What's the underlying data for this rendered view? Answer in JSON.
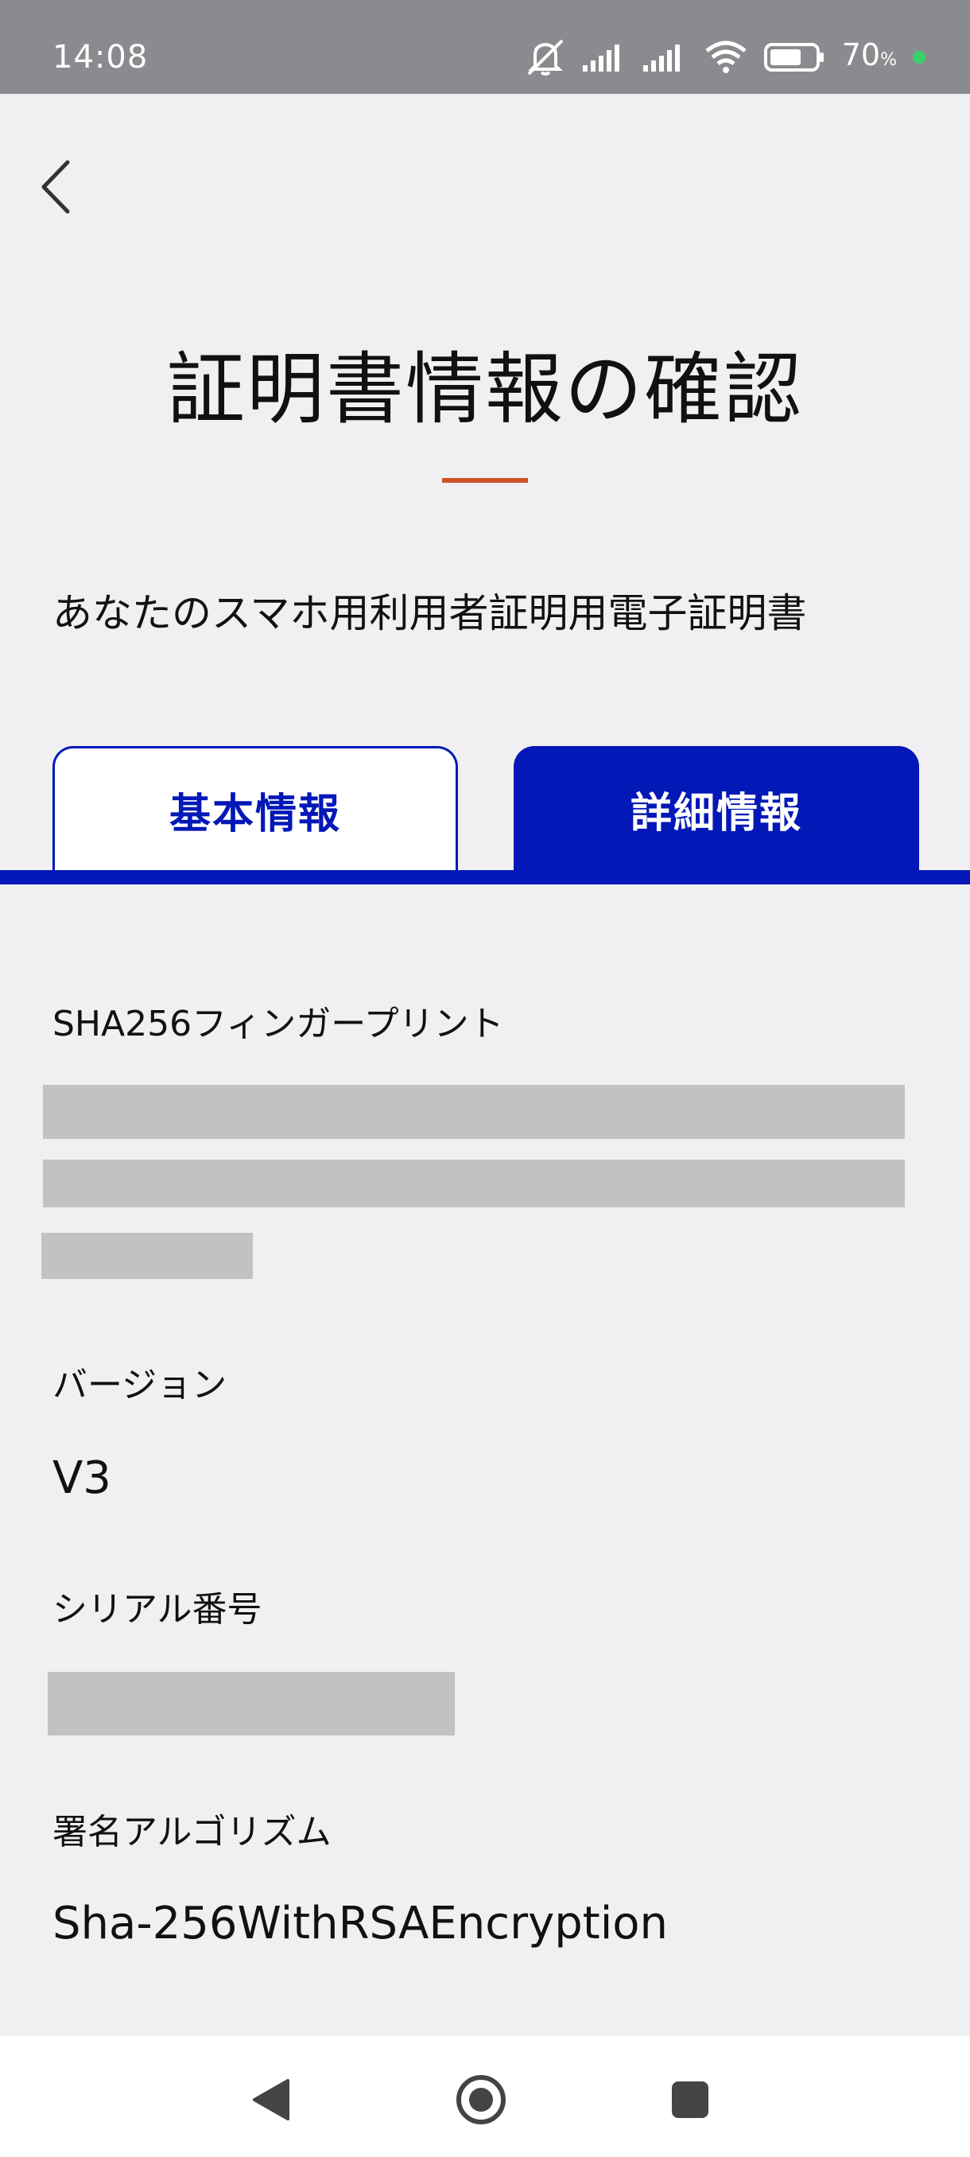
{
  "status_bar": {
    "time": "14:08",
    "battery_percent": "70",
    "battery_unit": "%",
    "battery_level": 0.7,
    "icons": [
      "mute-icon",
      "signal-icon",
      "signal-icon",
      "wifi-icon",
      "battery-icon",
      "charging-dot"
    ]
  },
  "header": {
    "back_icon": "chevron-left-icon",
    "title": "証明書情報の確認",
    "accent_color": "#d0522a"
  },
  "subtitle": "あなたのスマホ用利用者証明用電子証明書",
  "tabs": [
    {
      "label": "基本情報",
      "selected": false
    },
    {
      "label": "詳細情報",
      "selected": true
    }
  ],
  "tab_color": "#0418b8",
  "fields": {
    "fingerprint": {
      "label": "SHA256フィンガープリント",
      "value_redacted": true
    },
    "version": {
      "label": "バージョン",
      "value": "V3"
    },
    "serial": {
      "label": "シリアル番号",
      "value_redacted": true
    },
    "algorithm": {
      "label": "署名アルゴリズム",
      "value": "Sha-256WithRSAEncryption"
    }
  },
  "nav_bar": {
    "buttons": [
      "back-triangle-icon",
      "home-circle-icon",
      "recents-square-icon"
    ]
  }
}
